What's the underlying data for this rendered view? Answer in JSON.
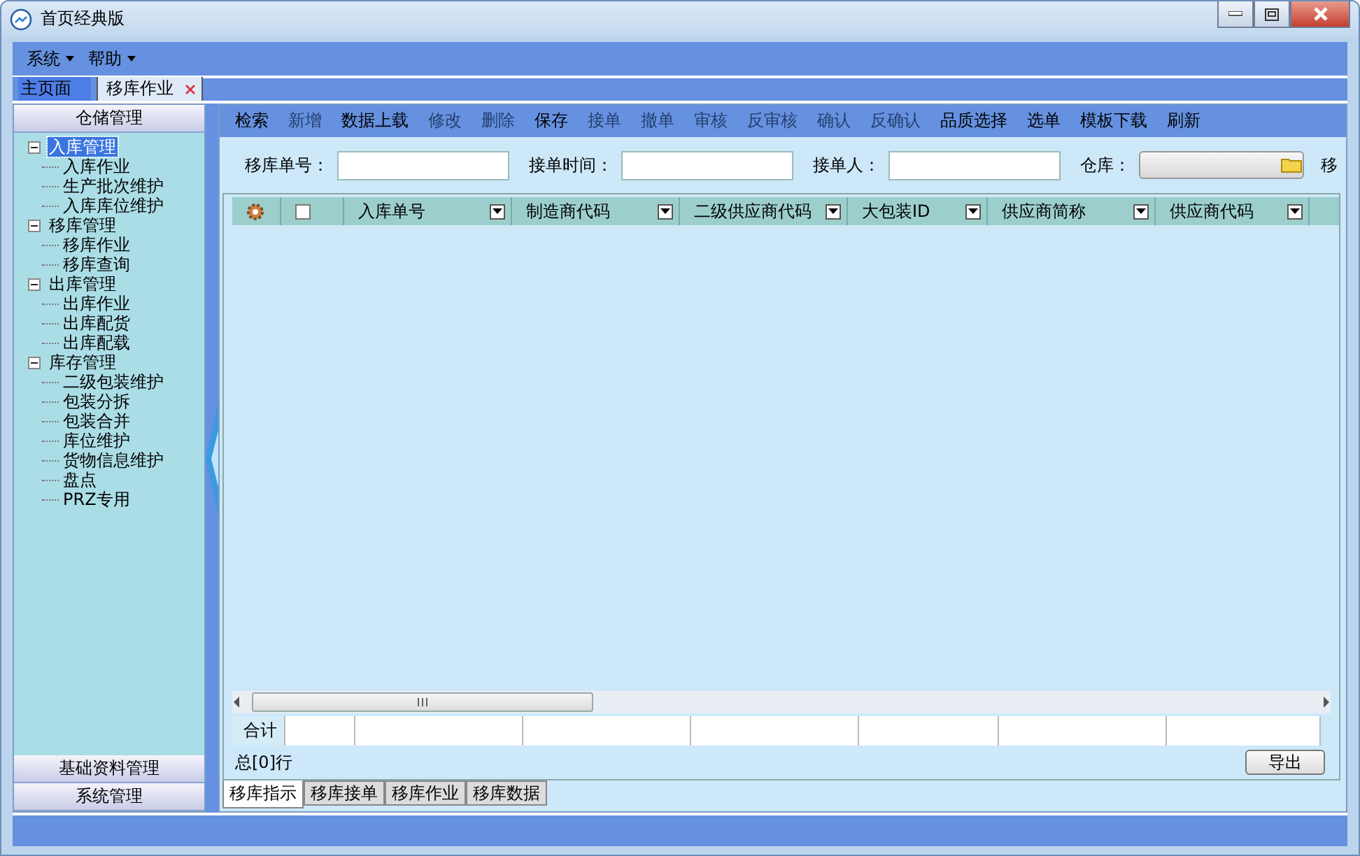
{
  "window": {
    "title": "首页经典版"
  },
  "menu": [
    {
      "label": "系统"
    },
    {
      "label": "帮助"
    }
  ],
  "doc_tabs": [
    {
      "label": "主页面",
      "selected": false,
      "closable": false
    },
    {
      "label": "移库作业",
      "selected": true,
      "closable": true
    }
  ],
  "sidebar": {
    "header": "仓储管理",
    "tree": [
      {
        "label": "入库管理",
        "selected": true,
        "expanded": true,
        "children": [
          {
            "label": "入库作业",
            "selected": false
          },
          {
            "label": "生产批次维护",
            "selected": false
          },
          {
            "label": "入库库位维护",
            "selected": false
          }
        ]
      },
      {
        "label": "移库管理",
        "selected": false,
        "expanded": true,
        "children": [
          {
            "label": "移库作业",
            "selected": false
          },
          {
            "label": "移库查询",
            "selected": false
          }
        ]
      },
      {
        "label": "出库管理",
        "selected": false,
        "expanded": true,
        "children": [
          {
            "label": "出库作业",
            "selected": false
          },
          {
            "label": "出库配货",
            "selected": false
          },
          {
            "label": "出库配载",
            "selected": false
          }
        ]
      },
      {
        "label": "库存管理",
        "selected": false,
        "expanded": true,
        "children": [
          {
            "label": "二级包装维护",
            "selected": false
          },
          {
            "label": "包装分拆",
            "selected": false
          },
          {
            "label": "包装合并",
            "selected": false
          },
          {
            "label": "库位维护",
            "selected": false
          },
          {
            "label": "货物信息维护",
            "selected": false
          },
          {
            "label": "盘点",
            "selected": false
          },
          {
            "label": "PRZ专用",
            "selected": false
          }
        ]
      }
    ],
    "sections": [
      {
        "label": "基础资料管理"
      },
      {
        "label": "系统管理"
      }
    ]
  },
  "toolbar": [
    {
      "label": "检索",
      "disabled": false
    },
    {
      "label": "新增",
      "disabled": true
    },
    {
      "label": "数据上载",
      "disabled": false
    },
    {
      "label": "修改",
      "disabled": true
    },
    {
      "label": "删除",
      "disabled": true
    },
    {
      "label": "保存",
      "disabled": false
    },
    {
      "label": "接单",
      "disabled": true
    },
    {
      "label": "撤单",
      "disabled": true
    },
    {
      "label": "审核",
      "disabled": true
    },
    {
      "label": "反审核",
      "disabled": true
    },
    {
      "label": "确认",
      "disabled": true
    },
    {
      "label": "反确认",
      "disabled": true
    },
    {
      "label": "品质选择",
      "disabled": false
    },
    {
      "label": "选单",
      "disabled": false
    },
    {
      "label": "模板下载",
      "disabled": false
    },
    {
      "label": "刷新",
      "disabled": false
    }
  ],
  "filters": [
    {
      "label": "移库单号：",
      "kind": "text"
    },
    {
      "label": "接单时间：",
      "kind": "text"
    },
    {
      "label": "接单人：",
      "kind": "text"
    },
    {
      "label": "仓库：",
      "kind": "picker"
    },
    {
      "label": "移",
      "kind": "label"
    }
  ],
  "table": {
    "select_all": {
      "checked": false
    },
    "columns": [
      "入库单号",
      "制造商代码",
      "二级供应商代码",
      "大包装ID",
      "供应商简称",
      "供应商代码"
    ],
    "summary_label": "合计",
    "row_count": "总[0]行"
  },
  "export_button": "导出",
  "bottom_tabs": [
    {
      "label": "移库指示",
      "selected": true
    },
    {
      "label": "移库接单",
      "selected": false
    },
    {
      "label": "移库作业",
      "selected": false
    },
    {
      "label": "移库数据",
      "selected": false
    }
  ]
}
